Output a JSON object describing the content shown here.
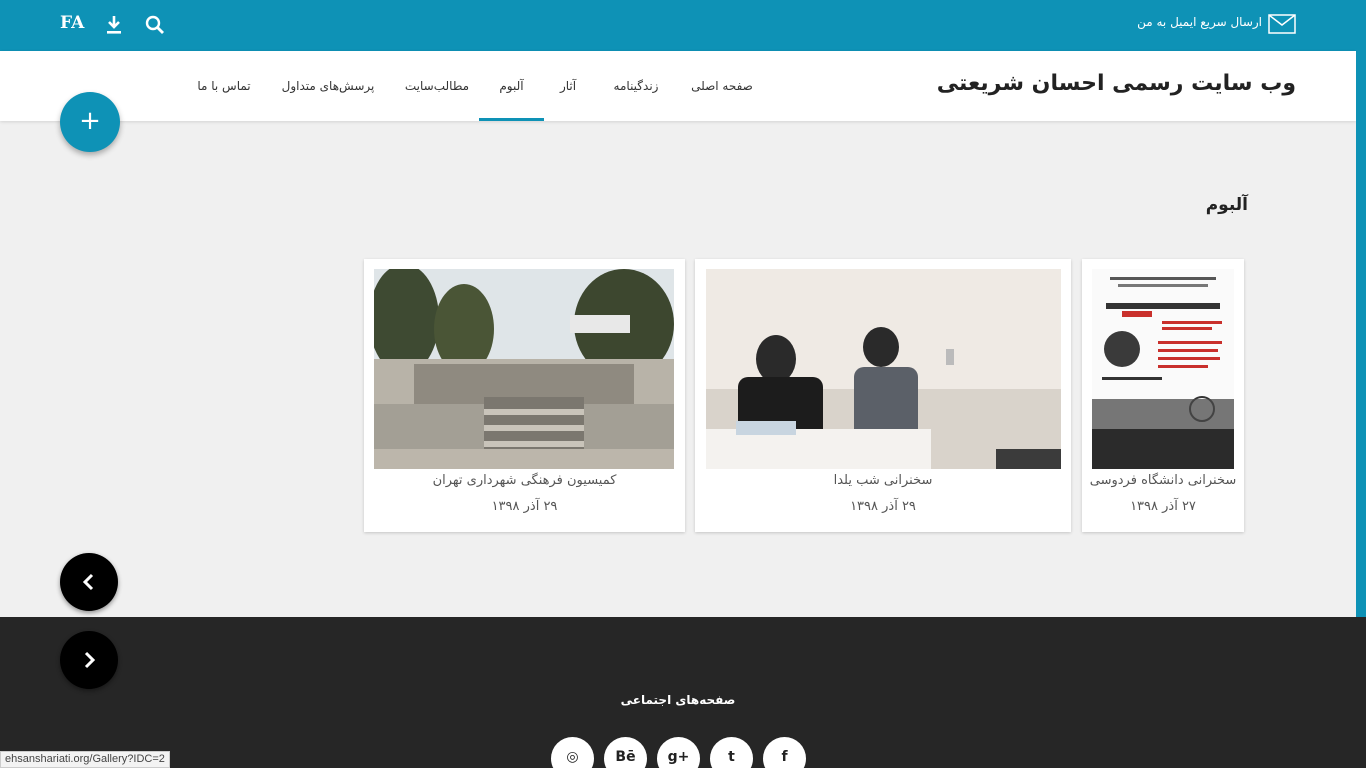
{
  "topbar": {
    "lang": "FA",
    "email_label": "ارسال سریع ایمیل به من",
    "icons": [
      "download-icon",
      "search-icon",
      "mail-icon"
    ]
  },
  "header": {
    "site_title": "وب سایت رسمی احسان شریعتی",
    "nav": [
      {
        "label": "صفحه اصلی",
        "active": false
      },
      {
        "label": "زندگینامه",
        "active": false
      },
      {
        "label": "آثار",
        "active": false
      },
      {
        "label": "آلبوم",
        "active": true
      },
      {
        "label": "مطالب‌سایت",
        "active": false
      },
      {
        "label": "پرسش‌های متداول",
        "active": false
      },
      {
        "label": "تماس با ما",
        "active": false
      }
    ]
  },
  "fab": {
    "symbol": "+"
  },
  "main": {
    "heading": "آلبوم",
    "cards": [
      {
        "caption": "سخنرانی دانشگاه فردوسی",
        "date": "۲۷ آذر ۱۳۹۸"
      },
      {
        "caption": "سخنرانی شب یلدا",
        "date": "۲۹ آذر ۱۳۹۸"
      },
      {
        "caption": "کمیسیون فرهنگی شهرداری تهران",
        "date": "۲۹ آذر ۱۳۹۸"
      }
    ]
  },
  "footer": {
    "title": "صفحه‌های اجتماعی",
    "social": [
      {
        "icon": "facebook-icon",
        "glyph": "f"
      },
      {
        "icon": "twitter-icon",
        "glyph": "t"
      },
      {
        "icon": "google-plus-icon",
        "glyph": "g+"
      },
      {
        "icon": "behance-icon",
        "glyph": "Bē"
      },
      {
        "icon": "dribbble-icon",
        "glyph": "◎"
      }
    ]
  },
  "status_bar": {
    "url": "ehsanshariati.org/Gallery?IDC=2"
  },
  "colors": {
    "accent": "#0e92b6",
    "footer": "#262626",
    "background": "#f0f0f0"
  }
}
